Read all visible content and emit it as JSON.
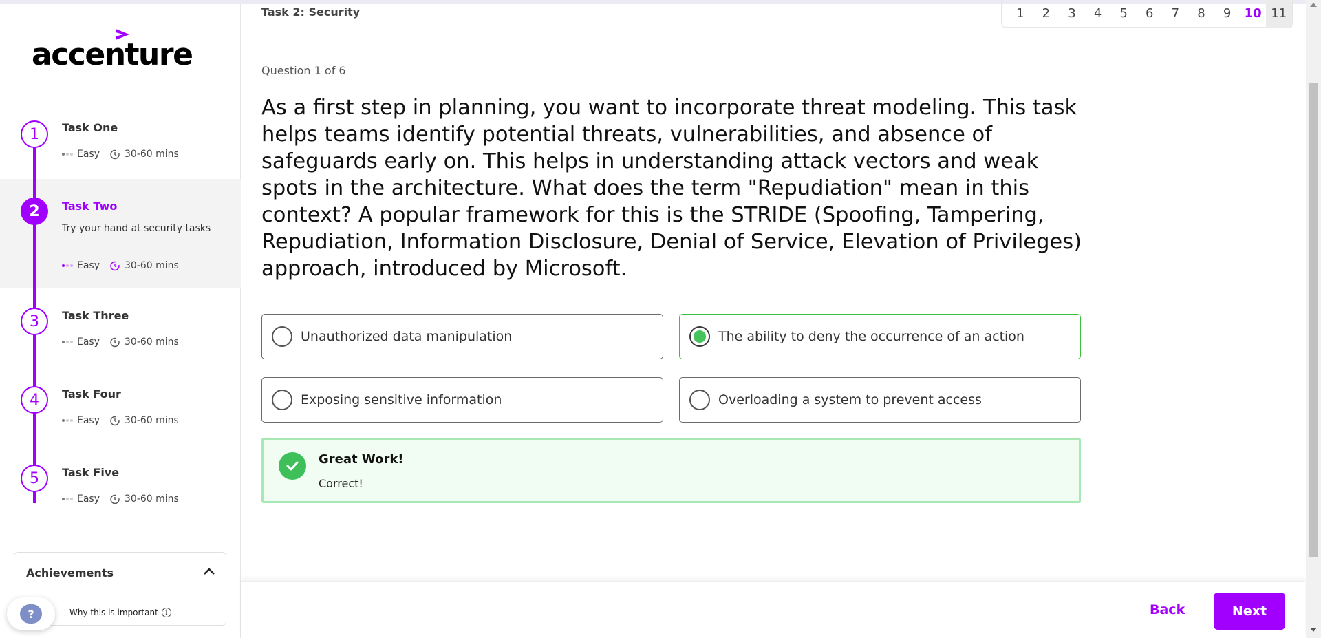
{
  "brand": {
    "name": "accenture",
    "accent_color": "#a100ff"
  },
  "sidebar": {
    "tasks": [
      {
        "number": "1",
        "title": "Task One",
        "difficulty": "Easy",
        "duration": "30-60 mins"
      },
      {
        "number": "2",
        "title": "Task Two",
        "subtitle": "Try your hand at security tasks",
        "difficulty": "Easy",
        "duration": "30-60 mins"
      },
      {
        "number": "3",
        "title": "Task Three",
        "difficulty": "Easy",
        "duration": "30-60 mins"
      },
      {
        "number": "4",
        "title": "Task Four",
        "difficulty": "Easy",
        "duration": "30-60 mins"
      },
      {
        "number": "5",
        "title": "Task Five",
        "difficulty": "Easy",
        "duration": "30-60 mins"
      }
    ],
    "achievements": {
      "title": "Achievements",
      "why_label": "Why this is important"
    },
    "help_label": "?"
  },
  "header": {
    "task_title": "Task 2: Security",
    "pages": [
      "1",
      "2",
      "3",
      "4",
      "5",
      "6",
      "7",
      "8",
      "9",
      "10",
      "11"
    ],
    "current_page": "10"
  },
  "question": {
    "counter": "Question 1 of 6",
    "text": "As a first step in planning, you want to incorporate threat modeling. This task helps teams identify potential threats, vulnerabilities, and absence of safeguards early on. This helps in understanding attack vectors and weak spots in the architecture. What does the term \"Repudiation\" mean in this context? A popular framework for this is the STRIDE (Spoofing, Tampering, Repudiation, Information Disclosure, Denial of Service, Elevation of Privileges) approach, introduced by Microsoft.",
    "options": [
      {
        "label": "Unauthorized data manipulation",
        "selected": false
      },
      {
        "label": "The ability to deny the occurrence of an action",
        "selected": true
      },
      {
        "label": "Exposing sensitive information",
        "selected": false
      },
      {
        "label": "Overloading a system to prevent access",
        "selected": false
      }
    ]
  },
  "feedback": {
    "title": "Great Work!",
    "message": "Correct!",
    "color": "#3fbf5a"
  },
  "footer": {
    "back_label": "Back",
    "next_label": "Next"
  }
}
